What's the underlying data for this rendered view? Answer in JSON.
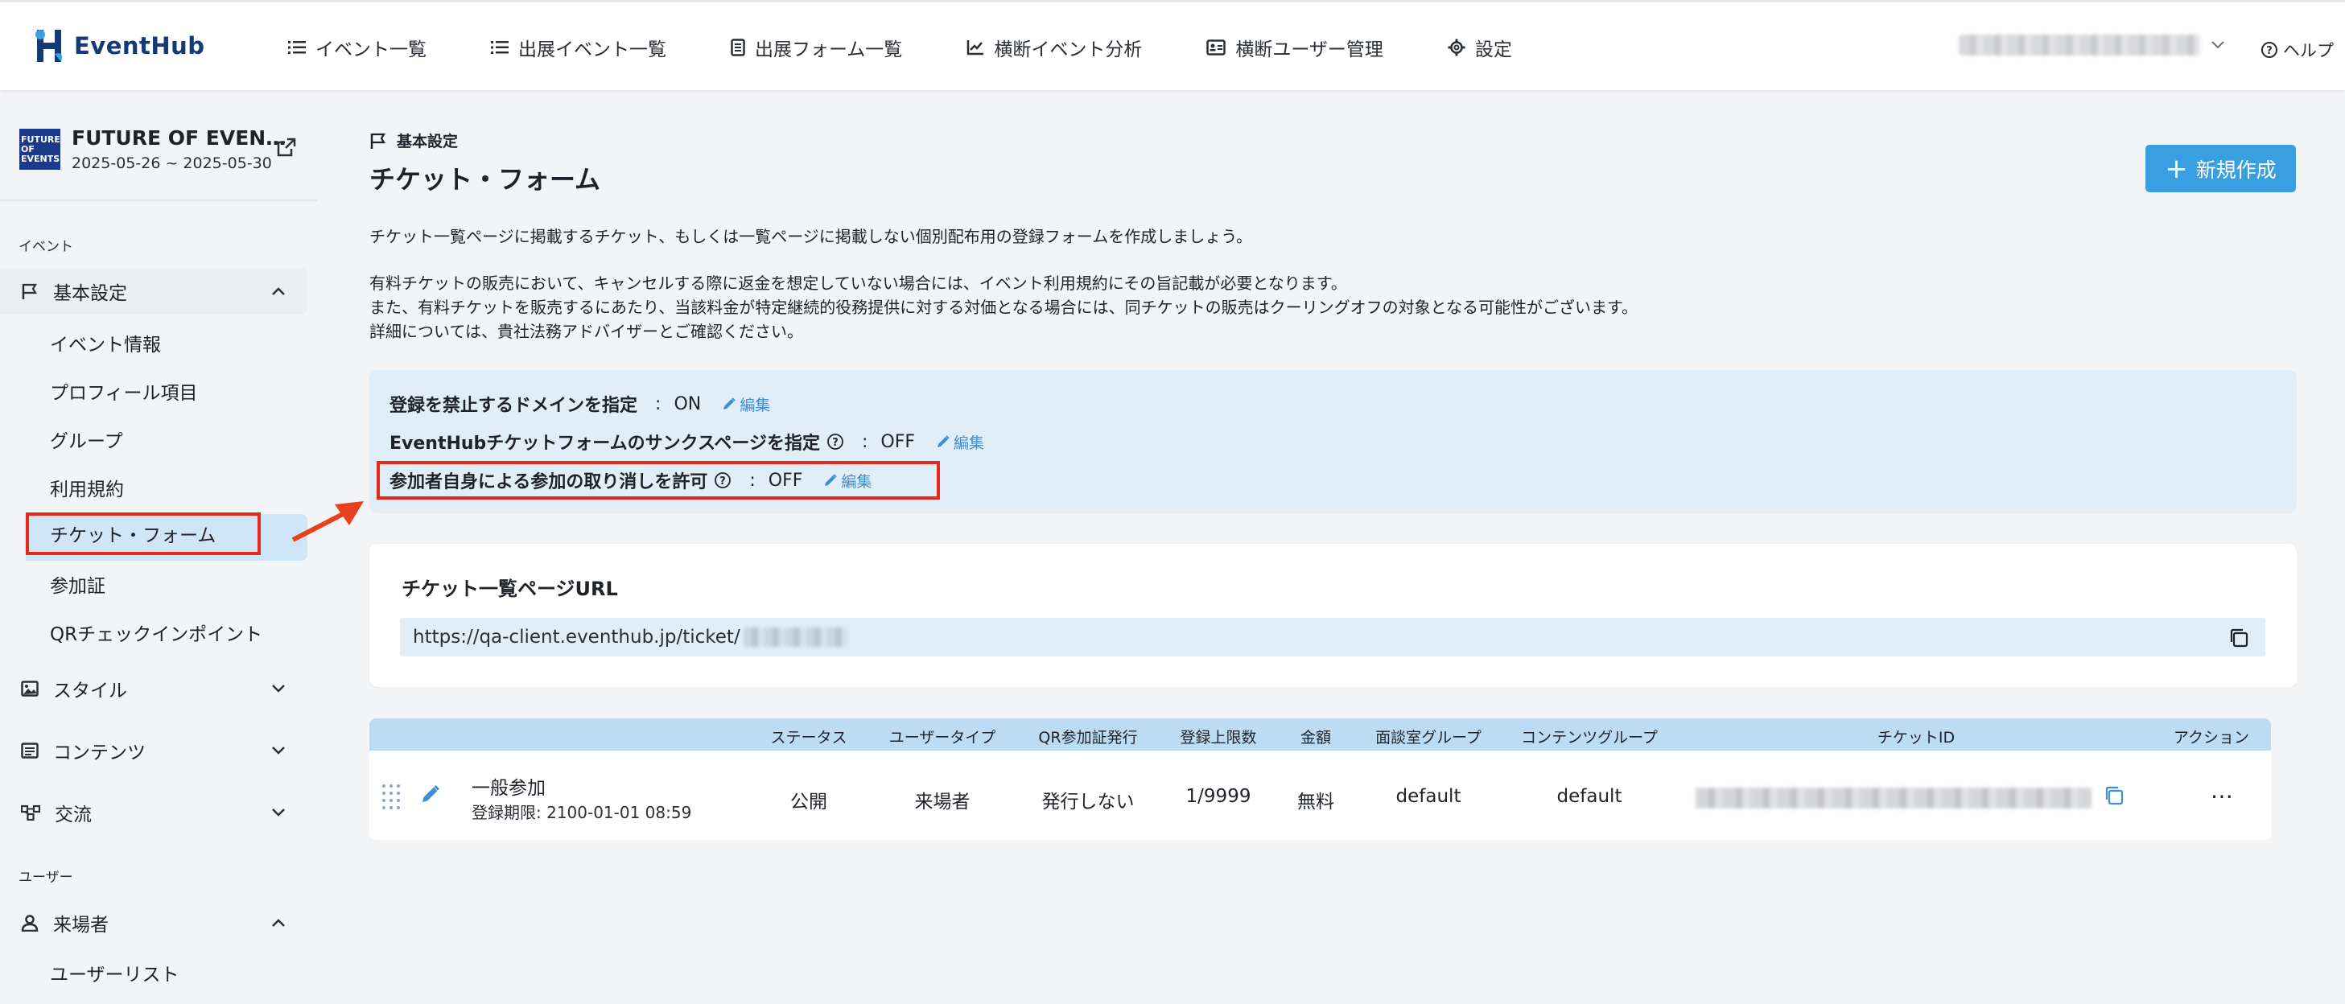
{
  "brand": {
    "name": "EventHub"
  },
  "nav": [
    {
      "label": "イベント一覧",
      "icon": "list-icon"
    },
    {
      "label": "出展イベント一覧",
      "icon": "list-icon"
    },
    {
      "label": "出展フォーム一覧",
      "icon": "form-icon"
    },
    {
      "label": "横断イベント分析",
      "icon": "chart-icon"
    },
    {
      "label": "横断ユーザー管理",
      "icon": "id-card-icon"
    },
    {
      "label": "設定",
      "icon": "gear-icon"
    }
  ],
  "help_label": "ヘルプ",
  "event": {
    "name": "FUTURE OF EVEN…",
    "dates": "2025-05-26 ~ 2025-05-30",
    "thumb_text": "FUTURE OF EVENTS"
  },
  "sidebar": {
    "section_event": "イベント",
    "group_basic": "基本設定",
    "items": [
      "イベント情報",
      "プロフィール項目",
      "グループ",
      "利用規約",
      "チケット・フォーム",
      "参加証",
      "QRチェックインポイント"
    ],
    "group_style": "スタイル",
    "group_content": "コンテンツ",
    "group_exchange": "交流",
    "section_user": "ユーザー",
    "group_visitor": "来場者",
    "visitor_items": [
      "ユーザーリスト"
    ]
  },
  "page": {
    "breadcrumb": "基本設定",
    "title": "チケット・フォーム",
    "new_button": "新規作成",
    "desc1": "チケット一覧ページに掲載するチケット、もしくは一覧ページに掲載しない個別配布用の登録フォームを作成しましょう。",
    "desc2": "有料チケットの販売において、キャンセルする際に返金を想定していない場合には、イベント利用規約にその旨記載が必要となります。",
    "desc3": "また、有料チケットを販売するにあたり、当該料金が特定継続的役務提供に対する対価となる場合には、同チケットの販売はクーリングオフの対象となる可能性がございます。",
    "desc4": "詳細については、貴社法務アドバイザーとご確認ください。"
  },
  "settings": [
    {
      "label": "登録を禁止するドメインを指定",
      "value": "ON",
      "edit": "編集"
    },
    {
      "label": "EventHubチケットフォームのサンクスページを指定",
      "value": "OFF",
      "edit": "編集"
    },
    {
      "label": "参加者自身による参加の取り消しを許可",
      "value": "OFF",
      "edit": "編集"
    }
  ],
  "colon": ":",
  "url_card": {
    "title": "チケット一覧ページURL",
    "url": "https://qa-client.eventhub.jp/ticket/"
  },
  "table": {
    "headers": [
      "ステータス",
      "ユーザータイプ",
      "QR参加証発行",
      "登録上限数",
      "金額",
      "面談室グループ",
      "コンテンツグループ",
      "チケットID",
      "アクション"
    ],
    "row": {
      "name": "一般参加",
      "period": "登録期限: 2100-01-01 08:59",
      "status": "公開",
      "user_type": "来場者",
      "qr": "発行しない",
      "limit": "1/9999",
      "price": "無料",
      "meeting_group": "default",
      "content_group": "default",
      "more": "⋯"
    }
  },
  "colors": {
    "accent": "#3a9fe0",
    "highlight": "#e8281a",
    "panel": "#e1eef8"
  }
}
